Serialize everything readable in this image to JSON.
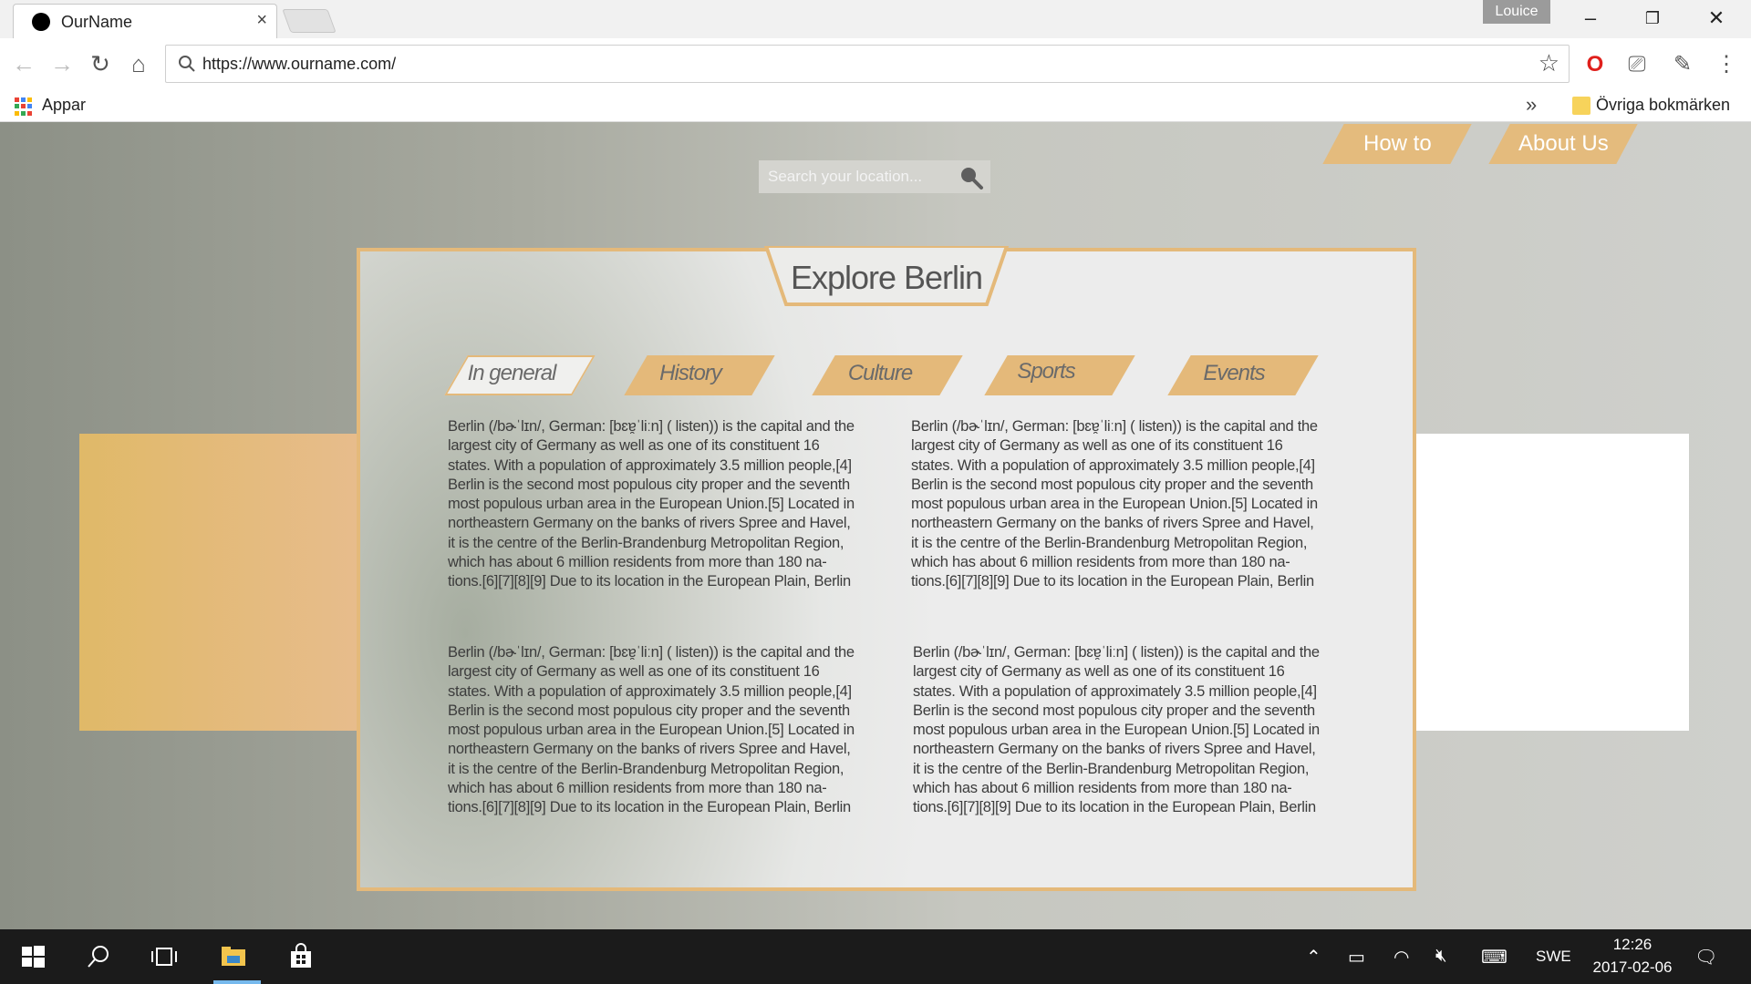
{
  "browser": {
    "tab_title": "OurName",
    "profile_name": "Louice",
    "url": "https://www.ourname.com/",
    "bookmarks": {
      "apps_label": "Appar",
      "other_label": "Övriga bokmärken",
      "more_label": "»"
    }
  },
  "page": {
    "search": {
      "placeholder": "Search your location..."
    },
    "nav": [
      {
        "label": "How to"
      },
      {
        "label": "About Us"
      }
    ],
    "panel": {
      "title": "Explore Berlin",
      "tabs": [
        {
          "label": "In general",
          "active": true
        },
        {
          "label": "History",
          "active": false
        },
        {
          "label": "Culture",
          "active": false
        },
        {
          "label": "Sports",
          "active": false
        },
        {
          "label": "Events",
          "active": false
        }
      ],
      "articles": [
        "Berlin (/bɚˈlɪn/, German: [bɛɐ̯ˈliːn] ( listen)) is the capital and the largest city of Germany as well as one of its constituent 16 states. With a population of approximately 3.5 million people,[4] Berlin is the second most populous city proper and the seventh most populous urban area in the European Union.[5] Located in northeastern Germany on the banks of rivers Spree and Havel, it is the centre of the Berlin-Brandenburg Metropolitan Region, which has about 6 million residents from more than 180 na-tions.[6][7][8][9] Due to its location in the European Plain, Berlin is influenced by a temperate seasonal climate. Around one-third",
        "Berlin (/bɚˈlɪn/, German: [bɛɐ̯ˈliːn] ( listen)) is the capital and the largest city of Germany as well as one of its constituent 16 states. With a population of approximately 3.5 million people,[4] Berlin is the second most populous city proper and the seventh most populous urban area in the European Union.[5] Located in northeastern Germany on the banks of rivers Spree and Havel, it is the centre of the Berlin-Brandenburg Metropolitan Region, which has about 6 million residents from more than 180 na-tions.[6][7][8][9] Due to its location in the European Plain, Berlin is influenced by a temperate seasonal climate. Around one-third",
        "Berlin (/bɚˈlɪn/, German: [bɛɐ̯ˈliːn] ( listen)) is the capital and the largest city of Germany as well as one of its constituent 16 states. With a population of approximately 3.5 million people,[4] Berlin is the second most populous city proper and the seventh most populous urban area in the European Union.[5] Located in northeastern Germany on the banks of rivers Spree and Havel, it is the centre of the Berlin-Brandenburg Metropolitan Region, which has about 6 million residents from more than 180 na-tions.[6][7][8][9] Due to its location in the European Plain, Berlin is influenced by a temperate seasonal climate. Around one-third",
        "Berlin (/bɚˈlɪn/, German: [bɛɐ̯ˈliːn] ( listen)) is the capital and the largest city of Germany as well as one of its constituent 16 states. With a population of approximately 3.5 million people,[4] Berlin is the second most populous city proper and the seventh most populous urban area in the European Union.[5] Located in northeastern Germany on the banks of rivers Spree and Havel, it is the centre of the Berlin-Brandenburg Metropolitan Region, which has about 6 million residents from more than 180 na-tions.[6][7][8][9] Due to its location in the European Plain, Berlin is influenced by a temperate seasonal climate. Around one-third"
      ]
    }
  },
  "taskbar": {
    "language": "SWE",
    "time": "12:26",
    "date": "2017-02-06"
  },
  "colors": {
    "accent": "#e4b97a",
    "taskbar": "#1b1b1b"
  },
  "icons": {
    "tab_favicon": "black-circle-icon",
    "search": "magnifier-icon"
  }
}
